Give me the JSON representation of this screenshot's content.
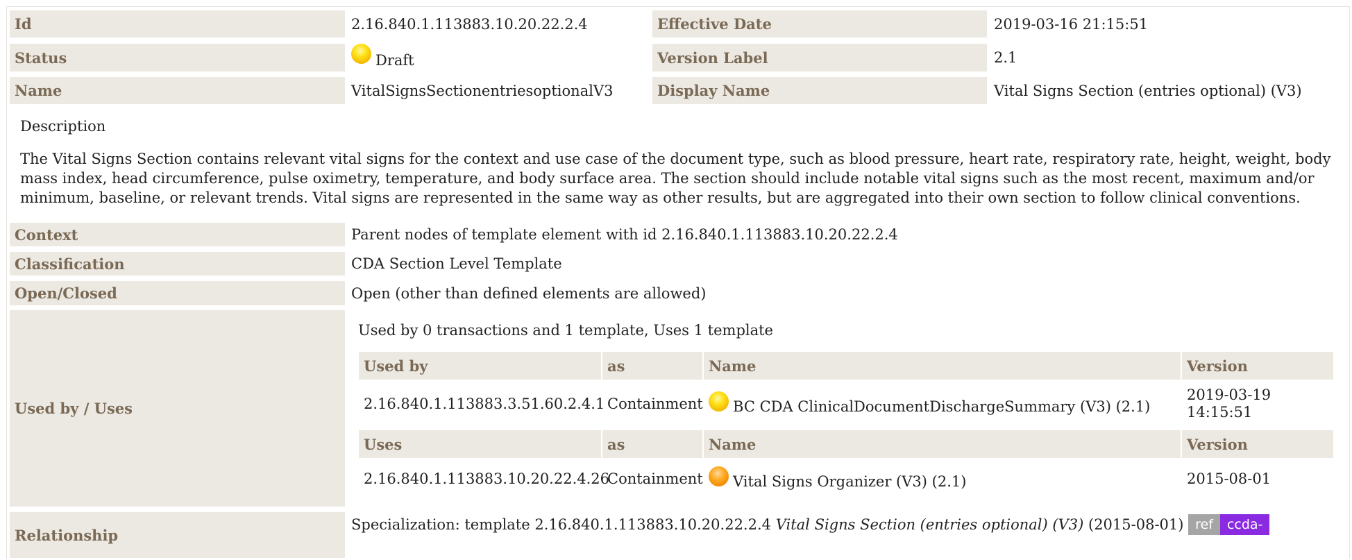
{
  "header": {
    "id_label": "Id",
    "id_value": "2.16.840.1.113883.10.20.22.2.4",
    "effective_date_label": "Effective Date",
    "effective_date_value": "2019-03-16 21:15:51",
    "status_label": "Status",
    "status_value": "Draft",
    "version_label_label": "Version Label",
    "version_label_value": "2.1",
    "name_label": "Name",
    "name_value": "VitalSignsSectionentriesoptionalV3",
    "display_name_label": "Display Name",
    "display_name_value": "Vital Signs Section (entries optional) (V3)"
  },
  "description": {
    "title": "Description",
    "text": "The Vital Signs Section contains relevant vital signs for the context and use case of the document type, such as blood pressure, heart rate, respiratory rate, height, weight, body mass index, head circumference, pulse oximetry, temperature, and body surface area. The section should include notable vital signs such as the most recent, maximum and/or minimum, baseline, or relevant trends. Vital signs are represented in the same way as other results, but are aggregated into their own section to follow clinical conventions."
  },
  "details": {
    "context_label": "Context",
    "context_value": "Parent nodes of template element with id 2.16.840.1.113883.10.20.22.2.4",
    "classification_label": "Classification",
    "classification_value": "CDA Section Level Template",
    "open_closed_label": "Open/Closed",
    "open_closed_value": "Open (other than defined elements are allowed)",
    "used_by_label": "Used by / Uses",
    "used_by_summary": "Used by 0 transactions and 1 template, Uses 1 template",
    "relationship_label": "Relationship"
  },
  "used_by_table": {
    "headers": [
      "Used by",
      "as",
      "Name",
      "Version"
    ],
    "row": {
      "id": "2.16.840.1.113883.3.51.60.2.4.1",
      "as": "Containment",
      "name": "BC CDA ClinicalDocumentDischargeSummary (V3) (2.1)",
      "version_line1": "2019-03-19",
      "version_line2": "14:15:51",
      "status_color": "#f2b600"
    }
  },
  "uses_table": {
    "headers": [
      "Uses",
      "as",
      "Name",
      "Version"
    ],
    "row": {
      "id": "2.16.840.1.113883.10.20.22.4.26",
      "as": "Containment",
      "name": "Vital Signs Organizer (V3) (2.1)",
      "version": "2015-08-01",
      "status_color": "#f08a00"
    }
  },
  "relationship": {
    "prefix": "Specialization: template 2.16.840.1.113883.10.20.22.2.4",
    "template_name": "Vital Signs Section (entries optional) (V3)",
    "date": "(2015-08-01)",
    "badge_ref": "ref",
    "badge_ccda": "ccda-",
    "badge_ref_color": "#a5a5a5",
    "badge_ccda_color": "#8a2be2"
  }
}
